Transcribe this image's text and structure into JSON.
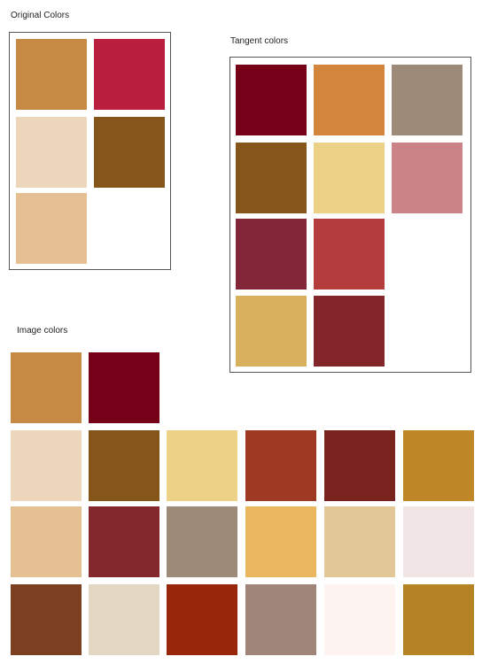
{
  "original": {
    "title": "Original Colors",
    "swatches": [
      "#c68a44",
      "#b91f3d",
      "#ecd7bc",
      "#86551a",
      "#e5c093"
    ]
  },
  "tangent": {
    "title": "Tangent colors",
    "swatches": [
      "#770019",
      "#d3853c",
      "#9e8a78",
      "#86551a",
      "#ecd287",
      "#cb8387",
      "#83263a",
      "#b43c3d",
      "#d9b05d",
      "#82262a"
    ]
  },
  "image": {
    "title": "Image colors",
    "swatches": [
      "#c68a44",
      "#770019",
      "#ecd7bc",
      "#86551a",
      "#ecd287",
      "#9e3a23",
      "#7a221e",
      "#bf8728",
      "#e5c093",
      "#83292d",
      "#9e8a78",
      "#eab65e",
      "#e3c897",
      "#f1e5e5",
      "#7c3f1f",
      "#e4d8c5",
      "#97260a",
      "#a08678",
      "#fdf3f0",
      "#b58323"
    ]
  }
}
